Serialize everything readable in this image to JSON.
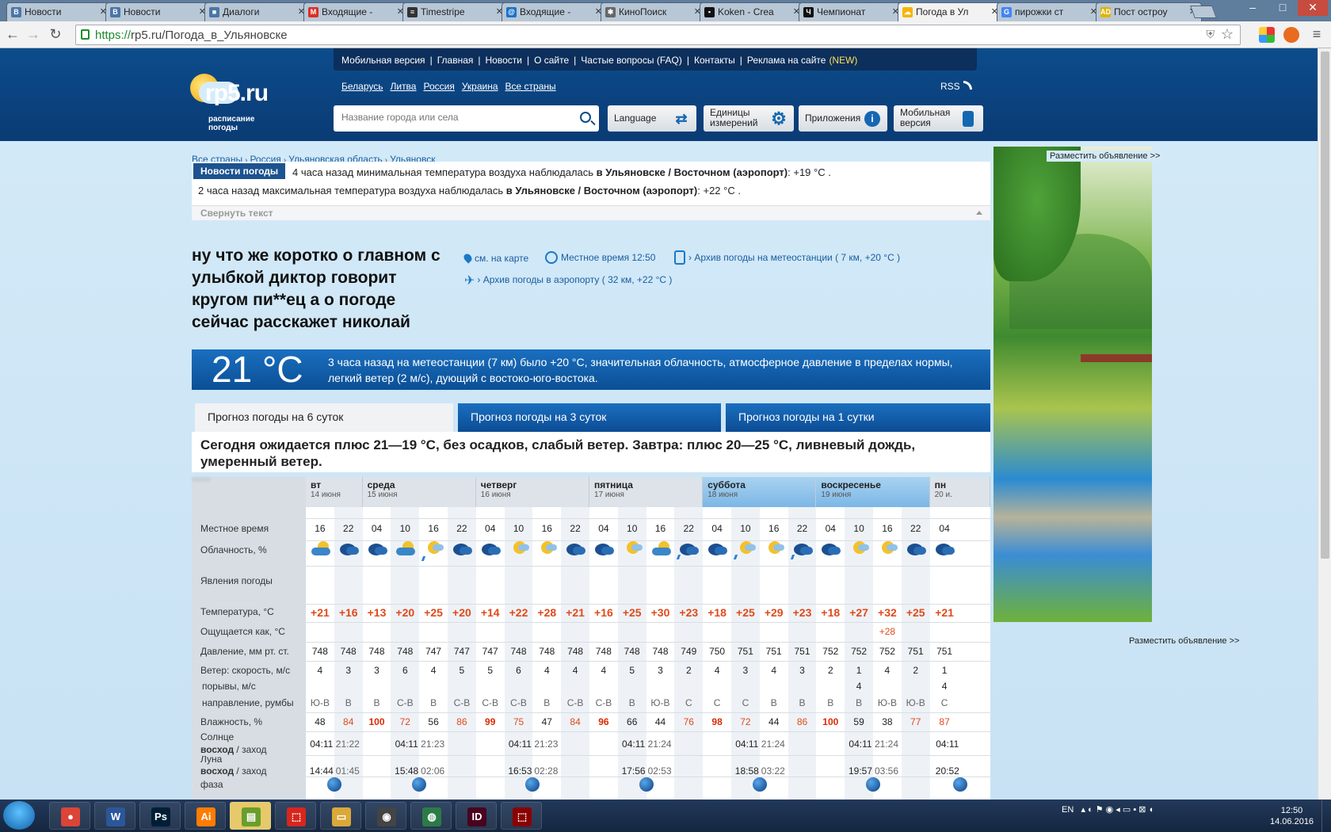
{
  "browser": {
    "tabs": [
      {
        "label": "Новости",
        "icon": "vk-icon",
        "color": "#4a76a8",
        "glyph": "B"
      },
      {
        "label": "Новости",
        "icon": "vk-icon",
        "color": "#4a76a8",
        "glyph": "B"
      },
      {
        "label": "Диалоги",
        "icon": "chat-icon",
        "color": "#4a76a8",
        "glyph": "■"
      },
      {
        "label": "Входящие -",
        "icon": "gmail-icon",
        "color": "#d93025",
        "glyph": "M"
      },
      {
        "label": "Timestripe",
        "icon": "list-icon",
        "color": "#333333",
        "glyph": "≡"
      },
      {
        "label": "Входящие -",
        "icon": "mail-ru-icon",
        "color": "#1a73c6",
        "glyph": "@"
      },
      {
        "label": "КиноПоиск",
        "icon": "kinopoisk-icon",
        "color": "#666666",
        "glyph": "✱"
      },
      {
        "label": "Koken - Crea",
        "icon": "koken-icon",
        "color": "#111111",
        "glyph": "▪"
      },
      {
        "label": "Чемпионат",
        "icon": "championat-icon",
        "color": "#111111",
        "glyph": "Ч"
      },
      {
        "label": "Погода в Ул",
        "icon": "weather-icon",
        "color": "#f5b400",
        "glyph": "☁"
      },
      {
        "label": "пирожки ст",
        "icon": "google-icon",
        "color": "#4285f4",
        "glyph": "G"
      },
      {
        "label": "Пост остроу",
        "icon": "ad-icon",
        "color": "#e0b400",
        "glyph": "AD"
      }
    ],
    "active_tab": 9,
    "url_scheme": "https://",
    "url_rest": "rp5.ru/Погода_в_Ульяновске"
  },
  "site": {
    "logo_text": "rp5.ru",
    "logo_sub": "расписание погоды",
    "topnav": [
      "Мобильная версия",
      "Главная",
      "Новости",
      "О сайте",
      "Частые вопросы (FAQ)",
      "Контакты",
      "Реклама на сайте"
    ],
    "topnav_new": "(NEW)",
    "countries": [
      "Беларусь",
      "Литва",
      "Россия",
      "Украина",
      "Все страны"
    ],
    "rss": "RSS",
    "search_placeholder": "Название города или села",
    "buttons": {
      "language": "Language",
      "units": "Единицы измерений",
      "apps": "Приложения",
      "mobile": "Мобильная версия"
    }
  },
  "ad": {
    "label": "Разместить объявление >>",
    "label_bottom": "Разместить объявление >>"
  },
  "breadcrumbs": [
    "Все страны",
    "Россия",
    "Ульяновская область",
    "Ульяновск"
  ],
  "news": {
    "label": "Новости погоды",
    "line1_pre": "4 часа назад минимальная температура воздуха наблюдалась",
    "line1_bold": "в Ульяновске / Восточном (аэропорт)",
    "line1_post": ": +19 °С .",
    "line2_pre": "2 часа назад максимальная температура воздуха наблюдалась",
    "line2_bold": "в Ульяновске / Восточном (аэропорт)",
    "line2_post": ": +22 °С .",
    "collapse": "Свернуть текст"
  },
  "headline": "ну что же коротко о главном с улыбкой диктор говорит кругом пи**ец а о погоде сейчас расскажет николай",
  "links": {
    "map": "см. на карте",
    "local_time": "Местное время  12:50",
    "archive_station": "› Архив погоды на метеостанции ( 7 км, +20 °С )",
    "archive_airport": "› Архив погоды в аэропорту ( 32 км, +22 °С )"
  },
  "current": {
    "temp": "21 °C",
    "desc": "3 часа назад на метеостанции (7 км) было +20 °С, значительная облачность, атмосферное давление в пределах нормы, легкий ветер (2 м/с), дующий с востоко-юго-востока."
  },
  "forecast_tabs": [
    "Прогноз погоды на 6 суток",
    "Прогноз погоды на 3 суток",
    "Прогноз погоды на 1 сутки"
  ],
  "summary": "Сегодня ожидается плюс 21—19 °С, без осадков, слабый ветер. Завтра: плюс 20—25 °С, ливневый дождь, умеренный ветер.",
  "table": {
    "row_labels": {
      "time": "Местное время",
      "clouds": "Облачность, %",
      "phenomena": "Явления погоды",
      "temp": "Температура, °С",
      "feels": "Ощущается как, °С",
      "pressure": "Давление, мм рт. ст.",
      "wind": "Ветер: скорость, м/с",
      "gusts": "порывы, м/с",
      "direction": "направление, румбы",
      "humidity": "Влажность, %",
      "sun": "Солнце",
      "sun_sub_a": "восход",
      "sun_sub_b": " / заход",
      "moon": "Луна",
      "moon_sub_a": "восход",
      "moon_sub_b": " / заход",
      "phase": "фаза"
    },
    "days": [
      {
        "name": "вт",
        "date": "14 июня",
        "weekend": false
      },
      {
        "name": "среда",
        "date": "15 июня",
        "weekend": false
      },
      {
        "name": "четверг",
        "date": "16 июня",
        "weekend": false
      },
      {
        "name": "пятница",
        "date": "17 июня",
        "weekend": false
      },
      {
        "name": "суббота",
        "date": "18 июня",
        "weekend": true
      },
      {
        "name": "воскресенье",
        "date": "19 июня",
        "weekend": true
      },
      {
        "name": "пн",
        "date": "20 и.",
        "weekend": false
      }
    ],
    "columns": [
      {
        "time": "16",
        "icon": "partly-cloudy",
        "temp": "+21",
        "feels": "",
        "pressure": "748",
        "wind": "4",
        "gust": "",
        "dir": "Ю-В",
        "humidity": "48"
      },
      {
        "time": "22",
        "icon": "cloudy-night",
        "temp": "+16",
        "feels": "",
        "pressure": "748",
        "wind": "3",
        "gust": "",
        "dir": "В",
        "humidity": "84"
      },
      {
        "time": "04",
        "icon": "cloudy-night",
        "temp": "+13",
        "feels": "",
        "pressure": "748",
        "wind": "3",
        "gust": "",
        "dir": "В",
        "humidity": "100"
      },
      {
        "time": "10",
        "icon": "partly-cloudy",
        "temp": "+20",
        "feels": "",
        "pressure": "748",
        "wind": "6",
        "gust": "",
        "dir": "С-В",
        "humidity": "72"
      },
      {
        "time": "16",
        "icon": "sunny-cloud",
        "temp": "+25",
        "feels": "",
        "pressure": "747",
        "wind": "4",
        "gust": "",
        "dir": "В",
        "humidity": "56"
      },
      {
        "time": "22",
        "icon": "cloudy-night",
        "temp": "+20",
        "feels": "",
        "pressure": "747",
        "wind": "5",
        "gust": "",
        "dir": "С-В",
        "humidity": "86"
      },
      {
        "time": "04",
        "icon": "cloudy-night",
        "temp": "+14",
        "feels": "",
        "pressure": "747",
        "wind": "5",
        "gust": "",
        "dir": "С-В",
        "humidity": "99"
      },
      {
        "time": "10",
        "icon": "sunny-cloud",
        "temp": "+22",
        "feels": "",
        "pressure": "748",
        "wind": "6",
        "gust": "",
        "dir": "С-В",
        "humidity": "75"
      },
      {
        "time": "16",
        "icon": "sunny-cloud",
        "temp": "+28",
        "feels": "",
        "pressure": "748",
        "wind": "4",
        "gust": "",
        "dir": "В",
        "humidity": "47"
      },
      {
        "time": "22",
        "icon": "cloudy-night",
        "temp": "+21",
        "feels": "",
        "pressure": "748",
        "wind": "4",
        "gust": "",
        "dir": "С-В",
        "humidity": "84"
      },
      {
        "time": "04",
        "icon": "cloudy-night",
        "temp": "+16",
        "feels": "",
        "pressure": "748",
        "wind": "4",
        "gust": "",
        "dir": "С-В",
        "humidity": "96"
      },
      {
        "time": "10",
        "icon": "sunny-cloud",
        "temp": "+25",
        "feels": "",
        "pressure": "748",
        "wind": "5",
        "gust": "",
        "dir": "В",
        "humidity": "66"
      },
      {
        "time": "16",
        "icon": "partly-cloudy",
        "temp": "+30",
        "feels": "",
        "pressure": "748",
        "wind": "3",
        "gust": "",
        "dir": "Ю-В",
        "humidity": "44"
      },
      {
        "time": "22",
        "icon": "cloudy-night",
        "temp": "+23",
        "feels": "",
        "pressure": "749",
        "wind": "2",
        "gust": "",
        "dir": "С",
        "humidity": "76"
      },
      {
        "time": "04",
        "icon": "cloudy-night",
        "temp": "+18",
        "feels": "",
        "pressure": "750",
        "wind": "4",
        "gust": "",
        "dir": "С",
        "humidity": "98"
      },
      {
        "time": "10",
        "icon": "sunny-cloud",
        "temp": "+25",
        "feels": "",
        "pressure": "751",
        "wind": "3",
        "gust": "",
        "dir": "С",
        "humidity": "72"
      },
      {
        "time": "16",
        "icon": "sunny-cloud",
        "temp": "+29",
        "feels": "",
        "pressure": "751",
        "wind": "4",
        "gust": "",
        "dir": "В",
        "humidity": "44"
      },
      {
        "time": "22",
        "icon": "cloudy-night",
        "temp": "+23",
        "feels": "",
        "pressure": "751",
        "wind": "3",
        "gust": "",
        "dir": "В",
        "humidity": "86"
      },
      {
        "time": "04",
        "icon": "cloudy-night",
        "temp": "+18",
        "feels": "",
        "pressure": "752",
        "wind": "2",
        "gust": "",
        "dir": "В",
        "humidity": "100"
      },
      {
        "time": "10",
        "icon": "sunny-cloud",
        "temp": "+27",
        "feels": "",
        "pressure": "752",
        "wind": "1",
        "gust": "4",
        "dir": "В",
        "humidity": "59"
      },
      {
        "time": "16",
        "icon": "sunny-cloud",
        "temp": "+32",
        "feels": "+28",
        "pressure": "752",
        "wind": "4",
        "gust": "",
        "dir": "Ю-В",
        "humidity": "38"
      },
      {
        "time": "22",
        "icon": "cloudy-night",
        "temp": "+25",
        "feels": "",
        "pressure": "751",
        "wind": "2",
        "gust": "",
        "dir": "Ю-В",
        "humidity": "77"
      },
      {
        "time": "04",
        "icon": "cloudy-night",
        "temp": "+21",
        "feels": "",
        "pressure": "751",
        "wind": "1",
        "gust": "4",
        "dir": "С",
        "humidity": "87"
      }
    ],
    "sun": [
      [
        "04:11",
        "21:22"
      ],
      [
        "04:11",
        "21:23"
      ],
      [
        "04:11",
        "21:23"
      ],
      [
        "04:11",
        "21:24"
      ],
      [
        "04:11",
        "21:24"
      ],
      [
        "04:11",
        "21:24"
      ],
      [
        "04:11",
        ""
      ]
    ],
    "moon": [
      [
        "14:44",
        "01:45"
      ],
      [
        "15:48",
        "02:06"
      ],
      [
        "16:53",
        "02:28"
      ],
      [
        "17:56",
        "02:53"
      ],
      [
        "18:58",
        "03:22"
      ],
      [
        "19:57",
        "03:56"
      ],
      [
        "20:52",
        ""
      ]
    ]
  },
  "taskbar": {
    "apps": [
      {
        "name": "chrome",
        "glyph": "●",
        "color": "#db4437"
      },
      {
        "name": "word",
        "glyph": "W",
        "color": "#2b579a"
      },
      {
        "name": "photoshop",
        "glyph": "Ps",
        "color": "#001e36"
      },
      {
        "name": "illustrator",
        "glyph": "Ai",
        "color": "#ff7c00"
      },
      {
        "name": "calculator",
        "glyph": "▤",
        "color": "#6a9e2b"
      },
      {
        "name": "acrobat",
        "glyph": "⬚",
        "color": "#d7261d"
      },
      {
        "name": "explorer",
        "glyph": "▭",
        "color": "#d9a93a"
      },
      {
        "name": "media",
        "glyph": "◉",
        "color": "#444444"
      },
      {
        "name": "globe",
        "glyph": "◍",
        "color": "#2c7b47"
      },
      {
        "name": "indesign",
        "glyph": "ID",
        "color": "#49021f"
      },
      {
        "name": "reader",
        "glyph": "⬚",
        "color": "#8b0000"
      }
    ],
    "lang": "EN",
    "time": "12:50",
    "date": "14.06.2016"
  }
}
